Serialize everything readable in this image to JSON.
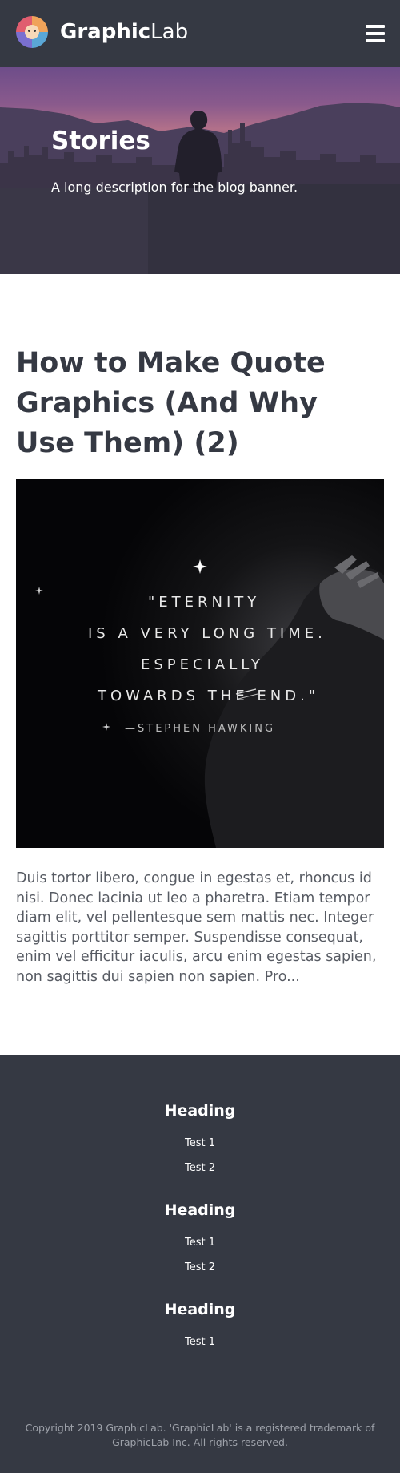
{
  "header": {
    "logo_bold": "Graphic",
    "logo_light": "Lab",
    "menu_icon": "hamburger-menu-icon"
  },
  "banner": {
    "title": "Stories",
    "description": "A long description for the blog banner."
  },
  "article": {
    "title": "How to Make Quote Graphics (And Why Use Them) (2)",
    "image_quote": {
      "line1": "\"ETERNITY",
      "line2": "IS A VERY LONG TIME.",
      "line3": "ESPECIALLY",
      "line4": "TOWARDS THE END.\"",
      "attribution": "—STEPHEN HAWKING"
    },
    "excerpt": "Duis tortor libero, congue in egestas et, rhoncus id nisi. Donec lacinia ut leo a pharetra. Etiam tempor diam elit, vel pellentesque sem mattis nec. Integer sagittis porttitor semper. Suspendisse consequat, enim vel efficitur iaculis, arcu enim egestas sapien, non sagittis dui sapien non sapien. Pro..."
  },
  "footer": {
    "sections": [
      {
        "heading": "Heading",
        "links": [
          "Test 1",
          "Test 2"
        ]
      },
      {
        "heading": "Heading",
        "links": [
          "Test 1",
          "Test 2"
        ]
      },
      {
        "heading": "Heading",
        "links": [
          "Test 1"
        ]
      }
    ],
    "copyright": "Copyright 2019 GraphicLab. 'GraphicLab' is a registered trademark of GraphicLab Inc. All rights reserved."
  },
  "colors": {
    "header_bg": "#353943",
    "footer_bg": "#353943",
    "title_text": "#353943",
    "body_text": "#575b63"
  }
}
